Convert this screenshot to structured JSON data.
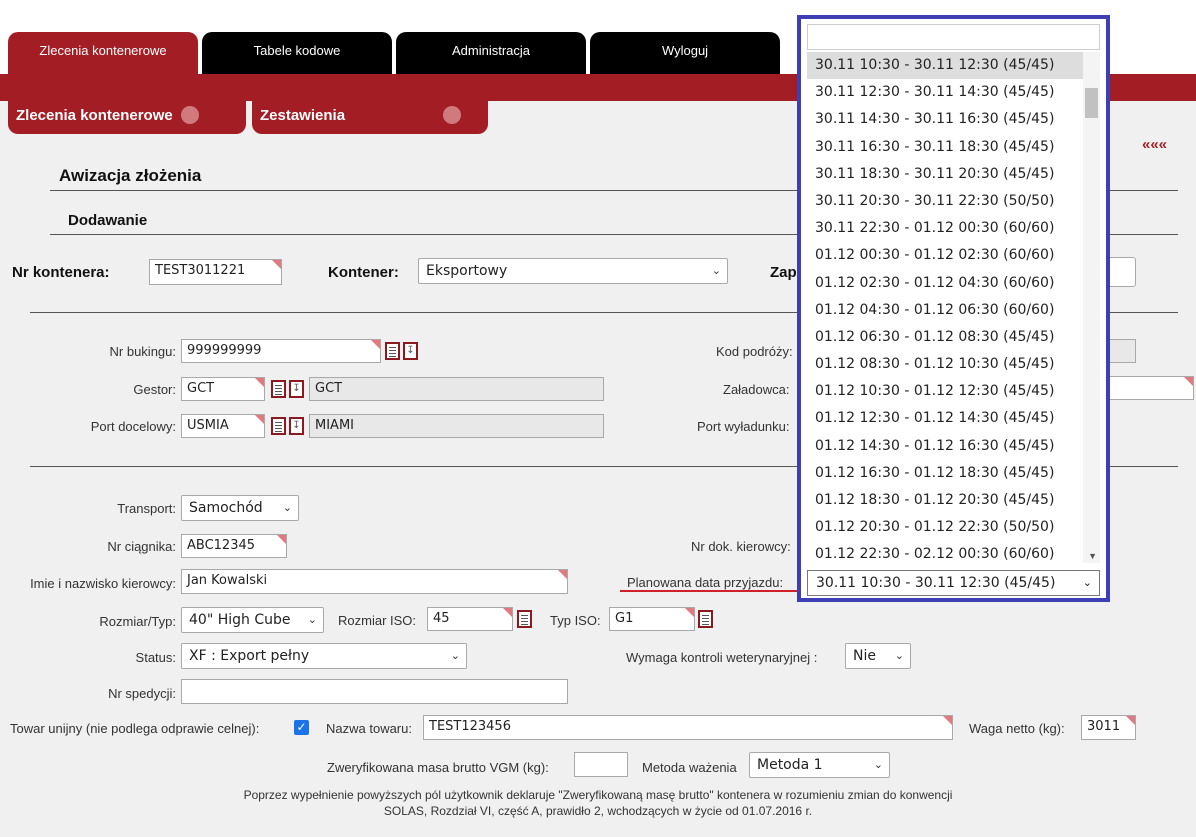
{
  "top_tabs": [
    {
      "label": "Zlecenia kontenerowe",
      "active": true
    },
    {
      "label": "Tabele kodowe",
      "active": false
    },
    {
      "label": "Administracja",
      "active": false
    },
    {
      "label": "Wyloguj",
      "active": false
    }
  ],
  "sub_tabs": [
    {
      "label": "Zlecenia kontenerowe"
    },
    {
      "label": "Zestawienia"
    }
  ],
  "collapse_icon": "«««",
  "page": {
    "title": "Awizacja złożenia",
    "subtitle": "Dodawanie"
  },
  "container": {
    "nr_label": "Nr kontenera:",
    "nr_value": "TEST3011221",
    "type_label": "Kontener:",
    "type_value": "Eksportowy",
    "cut_label": "Zap"
  },
  "booking": {
    "nr_bukingu_label": "Nr bukingu:",
    "nr_bukingu_value": "999999999",
    "gestor_label": "Gestor:",
    "gestor_code": "GCT",
    "gestor_name": "GCT",
    "port_label": "Port docelowy:",
    "port_code": "USMIA",
    "port_name": "MIAMI",
    "kod_podrozy_label": "Kod podróży:",
    "zaladowca_label": "Załadowca:",
    "port_wyladunku_label": "Port wyładunku:"
  },
  "transport": {
    "transport_label": "Transport:",
    "transport_value": "Samochód",
    "ciagnik_label": "Nr ciągnika:",
    "ciagnik_value": "ABC12345",
    "kierowca_label": "Imie i nazwisko kierowcy:",
    "kierowca_value": "Jan Kowalski",
    "nr_dok_label": "Nr dok. kierowcy:",
    "planowana_label": "Planowana data przyjazdu:",
    "planowana_value": "30.11 10:30 - 30.11 12:30 (45/45)",
    "rozmiar_label": "Rozmiar/Typ:",
    "rozmiar_value": "40\" High Cube",
    "rozmiar_iso_label": "Rozmiar ISO:",
    "rozmiar_iso_value": "45",
    "typ_iso_label": "Typ ISO:",
    "typ_iso_value": "G1",
    "status_label": "Status:",
    "status_value": "XF : Export pełny",
    "weterynaria_label": "Wymaga kontroli weterynaryjnej :",
    "weterynaria_value": "Nie",
    "spedycja_label": "Nr spedycji:",
    "spedycja_value": "",
    "towar_unijny_label": "Towar unijny (nie podlega odprawie celnej):",
    "nazwa_label": "Nazwa towaru:",
    "nazwa_value": "TEST123456",
    "waga_label": "Waga netto (kg):",
    "waga_value": "3011",
    "vgm_label": "Zweryfikowana masa brutto VGM (kg):",
    "vgm_value": "",
    "metoda_label": "Metoda ważenia",
    "metoda_value": "Metoda 1",
    "disclaimer_line1": "Poprzez wypełnienie powyższych pól użytkownik deklaruje \"Zweryfikowaną masę brutto\" kontenera w rozumieniu zmian do konwencji",
    "disclaimer_line2": "SOLAS, Rozdział VI, część A, prawidło 2, wchodzących w życie od 01.07.2016 r."
  },
  "dropdown_options": [
    "30.11 10:30 - 30.11 12:30 (45/45)",
    "30.11 12:30 - 30.11 14:30 (45/45)",
    "30.11 14:30 - 30.11 16:30 (45/45)",
    "30.11 16:30 - 30.11 18:30 (45/45)",
    "30.11 18:30 - 30.11 20:30 (45/45)",
    "30.11 20:30 - 30.11 22:30 (50/50)",
    "30.11 22:30 - 01.12 00:30 (60/60)",
    "01.12 00:30 - 01.12 02:30 (60/60)",
    "01.12 02:30 - 01.12 04:30 (60/60)",
    "01.12 04:30 - 01.12 06:30 (60/60)",
    "01.12 06:30 - 01.12 08:30 (45/45)",
    "01.12 08:30 - 01.12 10:30 (45/45)",
    "01.12 10:30 - 01.12 12:30 (45/45)",
    "01.12 12:30 - 01.12 14:30 (45/45)",
    "01.12 14:30 - 01.12 16:30 (45/45)",
    "01.12 16:30 - 01.12 18:30 (45/45)",
    "01.12 18:30 - 01.12 20:30 (45/45)",
    "01.12 20:30 - 01.12 22:30 (50/50)",
    "01.12 22:30 - 02.12 00:30 (60/60)"
  ],
  "colors": {
    "brand_red": "#a31d24",
    "highlight_border": "#3f3fb5",
    "underline": "#d0202a"
  }
}
